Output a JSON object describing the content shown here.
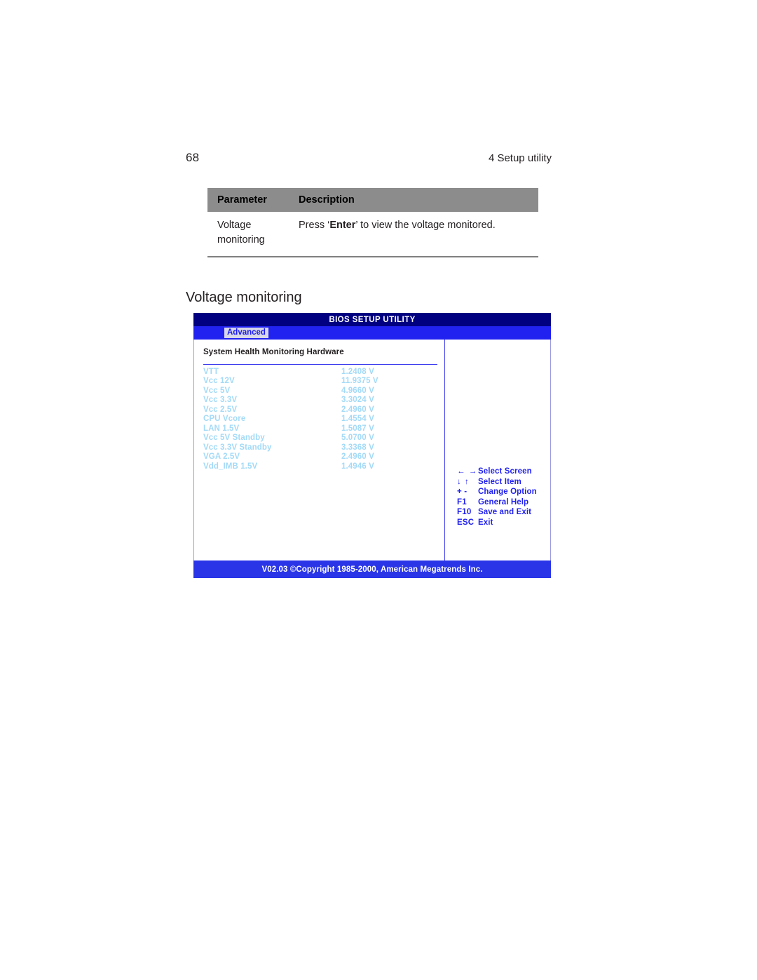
{
  "page": {
    "folio": "68",
    "running_head": "4 Setup utility",
    "section_title": "Voltage monitoring"
  },
  "parameter_table": {
    "headers": [
      "Parameter",
      "Description"
    ],
    "rows": [
      {
        "parameter": "Voltage monitoring",
        "description_before": "Press ‘",
        "description_bold": "Enter",
        "description_after": "’ to view the voltage monitored."
      }
    ]
  },
  "bios": {
    "title": "BIOS SETUP UTILITY",
    "tabs": [
      {
        "label": "Advanced",
        "selected": true
      }
    ],
    "panel_heading": "System Health Monitoring Hardware",
    "voltages": [
      {
        "name": "VTT",
        "value": "1.2408 V"
      },
      {
        "name": "Vcc 12V",
        "value": "11.9375 V"
      },
      {
        "name": "Vcc 5V",
        "value": "4.9660 V"
      },
      {
        "name": "Vcc 3.3V",
        "value": "3.3024 V"
      },
      {
        "name": "Vcc 2.5V",
        "value": "2.4960 V"
      },
      {
        "name": "CPU Vcore",
        "value": "1.4554 V"
      },
      {
        "name": "LAN 1.5V",
        "value": "1.5087 V"
      },
      {
        "name": "Vcc 5V Standby",
        "value": "5.0700 V"
      },
      {
        "name": "Vcc 3.3V Standby",
        "value": "3.3368 V"
      },
      {
        "name": "VGA 2.5V",
        "value": "2.4960 V"
      },
      {
        "name": "Vdd_IMB 1.5V",
        "value": "1.4946 V"
      }
    ],
    "key_help": [
      {
        "key": "← →",
        "label": "Select Screen"
      },
      {
        "key": "↓ ↑",
        "label": "Select Item"
      },
      {
        "key": "+ -",
        "label": "Change Option"
      },
      {
        "key": "F1",
        "label": "General Help"
      },
      {
        "key": "F10",
        "label": "Save and Exit"
      },
      {
        "key": "ESC",
        "label": "Exit"
      }
    ],
    "footer": "V02.03 ©Copyright 1985-2000, American Megatrends Inc.",
    "colors": {
      "title_bar": "#000080",
      "menu_bar": "#2121f0",
      "footer_bar": "#2a35e8",
      "value_text": "#a4daf7",
      "key_text": "#2121ee",
      "table_header": "#8c8c8c"
    }
  }
}
